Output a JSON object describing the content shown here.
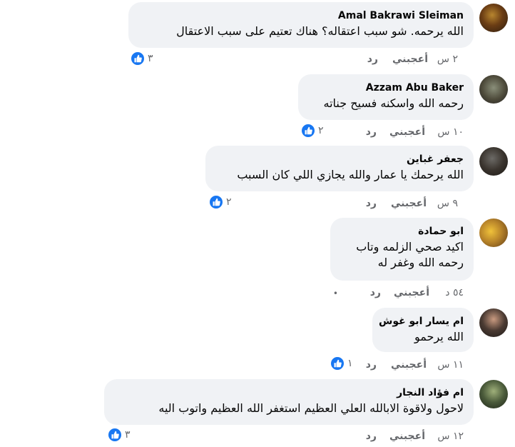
{
  "colors": {
    "bubble": "#f0f2f5",
    "meta_text": "#65676b",
    "like_blue": "#1877f2"
  },
  "comments": [
    {
      "author": "Amal Bakrawi Sleiman",
      "lines": [
        "الله يرحمه. شو سبب اعتقاله؟ هناك تعتيم على سبب الاعتقال"
      ],
      "time": "٢ س",
      "like_label": "أعجبني",
      "reply_label": "رد",
      "reactions": "٣",
      "avatar_icon": "profile-photo"
    },
    {
      "author": "Azzam Abu Baker",
      "lines": [
        "رحمه الله واسكنه فسيح جناته"
      ],
      "time": "١٠ س",
      "like_label": "أعجبني",
      "reply_label": "رد",
      "reactions": "٢",
      "avatar_icon": "profile-photo"
    },
    {
      "author": "جعفر غباين",
      "lines": [
        "الله يرحمك يا عمار والله يجازي اللي كان السبب"
      ],
      "time": "٩ س",
      "like_label": "أعجبني",
      "reply_label": "رد",
      "reactions": "٢",
      "avatar_icon": "profile-photo"
    },
    {
      "author": "ابو حمادة",
      "lines": [
        "اكيد صحي الزلمه وتاب",
        "رحمه الله وغفر له"
      ],
      "time": "٥٤ د",
      "like_label": "أعجبني",
      "reply_label": "رد",
      "reactions": "",
      "avatar_icon": "profile-photo"
    },
    {
      "author": "ام يسار ابو غوش",
      "lines": [
        "الله يرحمو"
      ],
      "time": "١١ س",
      "like_label": "أعجبني",
      "reply_label": "رد",
      "reactions": "١",
      "avatar_icon": "profile-photo"
    },
    {
      "author": "ام فؤاد النجار",
      "lines": [
        "لاحول ولاقوة الابالله العلي العظيم استغفر الله العظيم واتوب اليه"
      ],
      "time": "١٢ س",
      "like_label": "أعجبني",
      "reply_label": "رد",
      "reactions": "٣",
      "avatar_icon": "profile-photo"
    }
  ]
}
